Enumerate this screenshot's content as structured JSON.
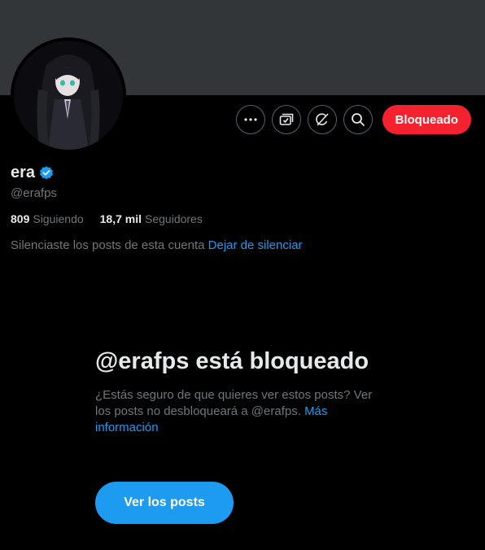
{
  "profile": {
    "display_name": "era",
    "handle": "@erafps",
    "verified_icon": "verified-badge-icon",
    "following_count": "809",
    "following_label": "Siguiendo",
    "followers_count": "18,7 mil",
    "followers_label": "Seguidores",
    "avatar": "avatar-image"
  },
  "actions": {
    "more_icon": "more-icon",
    "subscriptions_icon": "subscriptions-icon",
    "grok_icon": "grok-icon",
    "search_icon": "search-icon",
    "blocked_label": "Bloqueado"
  },
  "muted": {
    "text": "Silenciaste los posts de esta cuenta",
    "unmute_link": "Dejar de silenciar"
  },
  "blocked": {
    "title": "@erafps está bloqueado",
    "description": "¿Estás seguro de que quieres ver estos posts? Ver los posts no desbloqueará a @erafps.",
    "more_info_link": "Más información",
    "view_button": "Ver los posts"
  },
  "colors": {
    "background": "#000000",
    "banner": "#333639",
    "accent": "#1d9bf0",
    "danger": "#f4212e",
    "text_primary": "#e7e9ea",
    "text_secondary": "#71767b"
  }
}
